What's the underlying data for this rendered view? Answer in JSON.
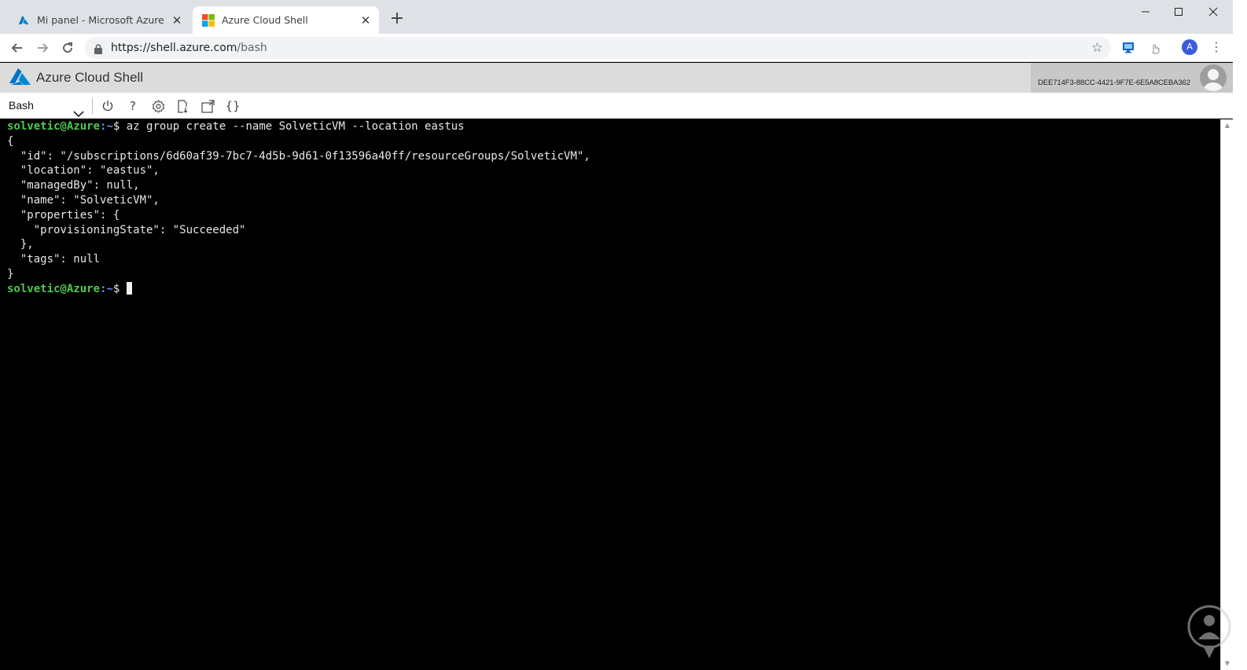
{
  "browser": {
    "tabs": [
      {
        "title": "Mi panel - Microsoft Azure",
        "icon": "azure-icon",
        "active": false
      },
      {
        "title": "Azure Cloud Shell",
        "icon": "microsoft-icon",
        "active": true
      }
    ],
    "new_tab": "+",
    "url_host": "https://shell.azure.com",
    "url_path": "/bash",
    "profile_initial": "A",
    "window_controls": {
      "minimize": "—",
      "maximize": "☐",
      "close": "✕"
    }
  },
  "header": {
    "title": "Azure Cloud Shell",
    "tenant_id": "DEE714F3-88CC-4421-9F7E-6E5A8CEBA362"
  },
  "shellbar": {
    "shell": "Bash",
    "buttons": [
      {
        "name": "restart-icon",
        "glyph": "⏻"
      },
      {
        "name": "help-icon",
        "glyph": "?"
      },
      {
        "name": "settings-icon",
        "glyph": "⚙"
      },
      {
        "name": "upload-download-icon",
        "glyph": ""
      },
      {
        "name": "open-session-icon",
        "glyph": ""
      },
      {
        "name": "editor-icon",
        "glyph": "{}"
      }
    ]
  },
  "terminal": {
    "prompt_user": "solvetic@Azure",
    "prompt_path": ":~",
    "prompt_sigil": "$",
    "command": " az group create --name SolveticVM --location eastus",
    "output": [
      "{",
      "  \"id\": \"/subscriptions/6d60af39-7bc7-4d5b-9d61-0f13596a40ff/resourceGroups/SolveticVM\",",
      "  \"location\": \"eastus\",",
      "  \"managedBy\": null,",
      "  \"name\": \"SolveticVM\",",
      "  \"properties\": {",
      "    \"provisioningState\": \"Succeeded\"",
      "  },",
      "  \"tags\": null",
      "}"
    ]
  },
  "colors": {
    "terminal_bg": "#000000",
    "prompt_green": "#4ec94e",
    "azure_blue": "#0078d4"
  }
}
